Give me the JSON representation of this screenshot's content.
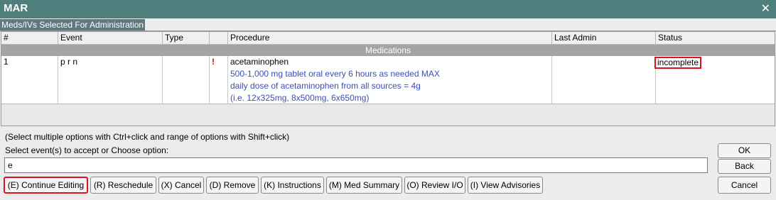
{
  "window": {
    "title": "MAR",
    "close_glyph": "✕"
  },
  "tab": {
    "label": "Meds/IVs Selected For Administration"
  },
  "table": {
    "columns": [
      "#",
      "Event",
      "Type",
      "",
      "Procedure",
      "Last Admin",
      "Status"
    ],
    "section_label": "Medications",
    "rows": [
      {
        "num": "1",
        "event": "p r n",
        "type": "",
        "flag": "!",
        "procedure_name": "acetaminophen",
        "procedure_detail": [
          "500-1,000 mg tablet oral every 6 hours as needed MAX",
          "daily dose of acetaminophen from all sources = 4g",
          "(i.e. 12x325mg, 8x500mg, 6x650mg)"
        ],
        "last_admin": "",
        "status": "incomplete"
      }
    ]
  },
  "hint_text": "(Select multiple options with Ctrl+click and range of options with Shift+click)",
  "prompt_text": "Select event(s) to accept or Choose option:",
  "input": {
    "value": "e"
  },
  "options": [
    "(E) Continue Editing",
    "(R) Reschedule",
    "(X) Cancel",
    "(D) Remove",
    "(K) Instructions",
    "(M) Med Summary",
    "(O) Review I/O",
    "(I) View Advisories"
  ],
  "right_buttons": {
    "ok": "OK",
    "back": "Back",
    "cancel": "Cancel"
  },
  "colors": {
    "titlebar": "#4f7f7c",
    "highlight": "#e0121c",
    "detail_text": "#3b4dbb"
  }
}
